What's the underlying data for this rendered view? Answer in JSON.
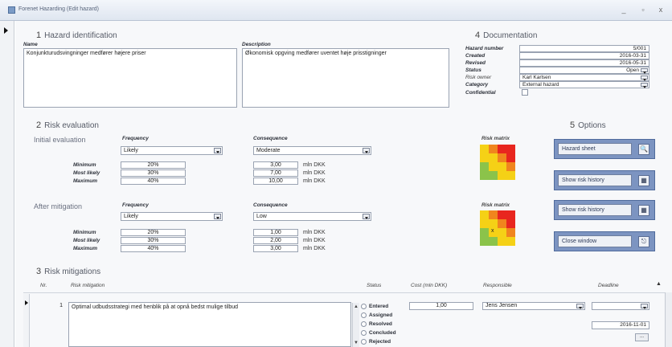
{
  "window": {
    "title": "Forenet Hazarding (Edit hazard)",
    "controls": [
      "_",
      "▫",
      "x"
    ]
  },
  "s1": {
    "num": "1",
    "title": "Hazard identification",
    "name_label": "Name",
    "name_value": "Konjunkturudsvingninger medfører højere priser",
    "desc_label": "Description",
    "desc_value": "Økonomisk opgving medfører uventet høje prisstigninger"
  },
  "s4": {
    "num": "4",
    "title": "Documentation",
    "hazard_number_label": "Hazard number",
    "hazard_number": "5/001",
    "created_label": "Created",
    "created": "2016-03-31",
    "revised_label": "Revised",
    "revised": "2016-05-31",
    "status_label": "Status",
    "status": "Open",
    "risk_owner_label": "Risk owner",
    "risk_owner": "Karl Karlsen",
    "category_label": "Category",
    "category": "External hazard",
    "confidential_label": "Confidential"
  },
  "s2": {
    "num": "2",
    "title": "Risk evaluation",
    "initial": {
      "label": "Initial evaluation",
      "frequency_label": "Frequency",
      "frequency": "Likely",
      "consequence_label": "Consequence",
      "consequence": "Moderate",
      "matrix_label": "Risk matrix",
      "rows": [
        {
          "label": "Minimum",
          "freq": "20%",
          "cons": "3,00",
          "unit": "mln DKK"
        },
        {
          "label": "Most likely",
          "freq": "30%",
          "cons": "7,00",
          "unit": "mln DKK"
        },
        {
          "label": "Maximum",
          "freq": "40%",
          "cons": "10,00",
          "unit": "mln DKK"
        }
      ]
    },
    "after": {
      "label": "After mitigation",
      "frequency_label": "Frequency",
      "frequency": "Likely",
      "consequence_label": "Consequence",
      "consequence": "Low",
      "matrix_label": "Risk matrix",
      "rows": [
        {
          "label": "Minimum",
          "freq": "20%",
          "cons": "1,00",
          "unit": "mln DKK"
        },
        {
          "label": "Most likely",
          "freq": "30%",
          "cons": "2,00",
          "unit": "mln DKK"
        },
        {
          "label": "Maximum",
          "freq": "40%",
          "cons": "3,00",
          "unit": "mln DKK"
        }
      ]
    }
  },
  "s5": {
    "num": "5",
    "title": "Options",
    "buttons": [
      "Hazard sheet",
      "Show risk history",
      "Show risk history",
      "Close window"
    ]
  },
  "s3": {
    "num": "3",
    "title": "Risk mitigations",
    "headers": {
      "nr": "Nr.",
      "mitigation": "Risk mitigation",
      "status": "Status",
      "cost": "Cost (mln DKK)",
      "responsible": "Responsible",
      "deadline": "Deadline"
    },
    "row": {
      "nr": "1",
      "mitigation": "Optimal udbudsstrategi med henblik på at opnå bedst mulige tilbud",
      "statuses": [
        "Entered",
        "Assigned",
        "Resolved",
        "Concluded",
        "Rejected"
      ],
      "cost": "1,00",
      "responsible": "Jens Jensen",
      "deadline": "2016-11-01",
      "deadline_btn": "..."
    }
  },
  "colors": {
    "green": "#8bc34a",
    "yellow": "#f5d116",
    "orange": "#f0851e",
    "red": "#e8261f",
    "option_bg": "#7c94c1"
  }
}
